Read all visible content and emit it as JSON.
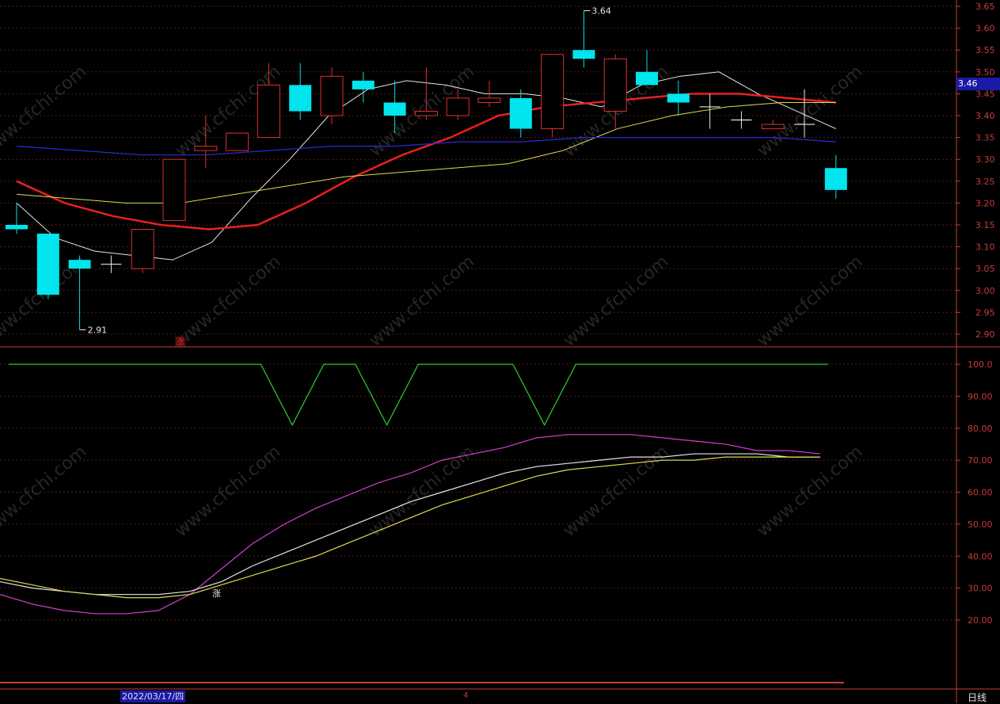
{
  "chart_data": [
    {
      "type": "candlestick",
      "period": "日线",
      "date_label": "2022/03/17/四",
      "cursor_label": "4",
      "last_price": "3.46",
      "y_ticks": [
        "3.65",
        "3.60",
        "3.55",
        "3.50",
        "3.45",
        "3.40",
        "3.35",
        "3.30",
        "3.25",
        "3.20",
        "3.15",
        "3.10",
        "3.05",
        "3.00",
        "2.95",
        "2.90"
      ],
      "ylim": [
        2.88,
        3.66
      ],
      "candles": [
        {
          "o": 3.15,
          "h": 3.2,
          "l": 3.13,
          "c": 3.14
        },
        {
          "o": 3.13,
          "h": 3.13,
          "l": 2.98,
          "c": 2.99
        },
        {
          "o": 3.07,
          "h": 3.08,
          "l": 2.91,
          "c": 3.05
        },
        {
          "o": 3.06,
          "h": 3.08,
          "l": 3.04,
          "c": 3.06
        },
        {
          "o": 3.05,
          "h": 3.14,
          "l": 3.04,
          "c": 3.14
        },
        {
          "o": 3.16,
          "h": 3.3,
          "l": 3.16,
          "c": 3.3
        },
        {
          "o": 3.32,
          "h": 3.4,
          "l": 3.28,
          "c": 3.33
        },
        {
          "o": 3.32,
          "h": 3.36,
          "l": 3.32,
          "c": 3.36
        },
        {
          "o": 3.35,
          "h": 3.52,
          "l": 3.35,
          "c": 3.47
        },
        {
          "o": 3.47,
          "h": 3.52,
          "l": 3.39,
          "c": 3.41
        },
        {
          "o": 3.4,
          "h": 3.51,
          "l": 3.38,
          "c": 3.49
        },
        {
          "o": 3.48,
          "h": 3.5,
          "l": 3.43,
          "c": 3.46
        },
        {
          "o": 3.43,
          "h": 3.48,
          "l": 3.36,
          "c": 3.4
        },
        {
          "o": 3.4,
          "h": 3.51,
          "l": 3.39,
          "c": 3.41
        },
        {
          "o": 3.4,
          "h": 3.46,
          "l": 3.39,
          "c": 3.44
        },
        {
          "o": 3.43,
          "h": 3.48,
          "l": 3.42,
          "c": 3.44
        },
        {
          "o": 3.44,
          "h": 3.46,
          "l": 3.35,
          "c": 3.37
        },
        {
          "o": 3.37,
          "h": 3.54,
          "l": 3.35,
          "c": 3.54
        },
        {
          "o": 3.55,
          "h": 3.64,
          "l": 3.51,
          "c": 3.53
        },
        {
          "o": 3.41,
          "h": 3.54,
          "l": 3.37,
          "c": 3.53
        },
        {
          "o": 3.5,
          "h": 3.55,
          "l": 3.47,
          "c": 3.47
        },
        {
          "o": 3.45,
          "h": 3.48,
          "l": 3.4,
          "c": 3.43
        },
        {
          "o": 3.42,
          "h": 3.45,
          "l": 3.37,
          "c": 3.42
        },
        {
          "o": 3.39,
          "h": 3.41,
          "l": 3.37,
          "c": 3.39
        },
        {
          "o": 3.37,
          "h": 3.39,
          "l": 3.37,
          "c": 3.38
        },
        {
          "o": 3.38,
          "h": 3.46,
          "l": 3.35,
          "c": 3.38
        },
        {
          "o": 3.28,
          "h": 3.31,
          "l": 3.21,
          "c": 3.23
        }
      ],
      "annotations": [
        {
          "text": "3.64",
          "x_index": 18,
          "value": 3.64
        },
        {
          "text": "2.91",
          "x_index": 2,
          "value": 2.91
        }
      ],
      "marker": "涨",
      "ma": {
        "white": [
          3.2,
          3.12,
          3.09,
          3.08,
          3.07,
          3.11,
          3.21,
          3.3,
          3.4,
          3.46,
          3.48,
          3.47,
          3.45,
          3.45,
          3.44,
          3.42,
          3.47,
          3.49,
          3.5,
          3.45,
          3.41,
          3.37
        ],
        "red": [
          3.25,
          3.2,
          3.17,
          3.15,
          3.14,
          3.15,
          3.2,
          3.26,
          3.31,
          3.35,
          3.4,
          3.42,
          3.43,
          3.44,
          3.45,
          3.45,
          3.44,
          3.43
        ],
        "yellow": [
          3.22,
          3.21,
          3.2,
          3.2,
          3.22,
          3.24,
          3.26,
          3.27,
          3.28,
          3.29,
          3.32,
          3.37,
          3.4,
          3.42,
          3.43,
          3.43
        ],
        "blue": [
          3.33,
          3.32,
          3.31,
          3.31,
          3.32,
          3.33,
          3.33,
          3.34,
          3.34,
          3.35,
          3.35,
          3.35,
          3.35,
          3.34
        ]
      }
    },
    {
      "type": "line",
      "y_ticks": [
        "100.0",
        "90.00",
        "80.00",
        "70.00",
        "60.00",
        "50.00",
        "40.00",
        "30.00",
        "20.00"
      ],
      "ylim": [
        10,
        105
      ],
      "marker": "涨",
      "series": [
        {
          "color": "#2bd12b",
          "values": [
            100,
            100,
            100,
            100,
            100,
            100,
            100,
            100,
            100,
            81,
            100,
            100,
            81,
            100,
            100,
            100,
            100,
            81,
            100,
            100,
            100,
            100,
            100,
            100,
            100,
            100,
            100
          ]
        },
        {
          "color": "#d040d0",
          "values": [
            28,
            25,
            23,
            22,
            22,
            23,
            28,
            36,
            44,
            50,
            55,
            59,
            63,
            66,
            70,
            72,
            74,
            77,
            78,
            78,
            78,
            77,
            76,
            75,
            73,
            73,
            72
          ]
        },
        {
          "color": "#e6e6e6",
          "values": [
            32,
            30,
            29,
            28,
            28,
            28,
            29,
            32,
            37,
            41,
            45,
            49,
            53,
            57,
            60,
            63,
            66,
            68,
            69,
            70,
            71,
            71,
            72,
            72,
            72,
            71,
            71
          ]
        },
        {
          "color": "#dcdc50",
          "values": [
            33,
            31,
            29,
            28,
            27,
            27,
            28,
            31,
            34,
            37,
            40,
            44,
            48,
            52,
            56,
            59,
            62,
            65,
            67,
            68,
            69,
            70,
            70,
            71,
            71,
            71,
            71
          ]
        }
      ]
    }
  ],
  "colors": {
    "up": "#e03030",
    "down": "#00e5ee",
    "axis": "#c83c3c",
    "grid": "#5a1a1a"
  },
  "watermark": "www.cfchi.com"
}
